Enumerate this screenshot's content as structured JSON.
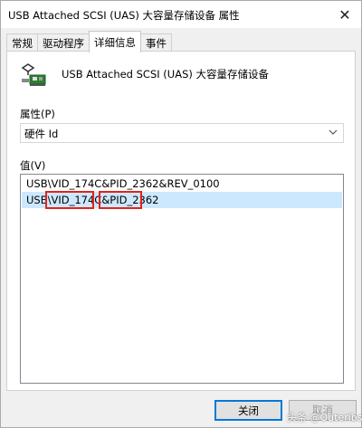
{
  "window": {
    "title": "USB Attached SCSI (UAS) 大容量存储设备 属性",
    "close_glyph": "✕"
  },
  "tabs": [
    {
      "label": "常规"
    },
    {
      "label": "驱动程序"
    },
    {
      "label": "详细信息",
      "active": true
    },
    {
      "label": "事件"
    }
  ],
  "device": {
    "name": "USB Attached SCSI (UAS) 大容量存储设备",
    "icon": "usb-storage-device-icon"
  },
  "property": {
    "label": "属性(P)",
    "selected": "硬件 Id"
  },
  "value": {
    "label": "值(V)",
    "items": [
      {
        "text": "USB\\VID_174C&PID_2362&REV_0100",
        "selected": false
      },
      {
        "text": "USB\\VID_174C&PID_2362",
        "selected": true
      }
    ],
    "highlight_color": "#e2231a"
  },
  "buttons": {
    "ok": "关闭",
    "cancel": "取消"
  },
  "watermark": "头条 @Outeribs",
  "colors": {
    "accent": "#0078d7",
    "selection": "#cce8ff"
  }
}
